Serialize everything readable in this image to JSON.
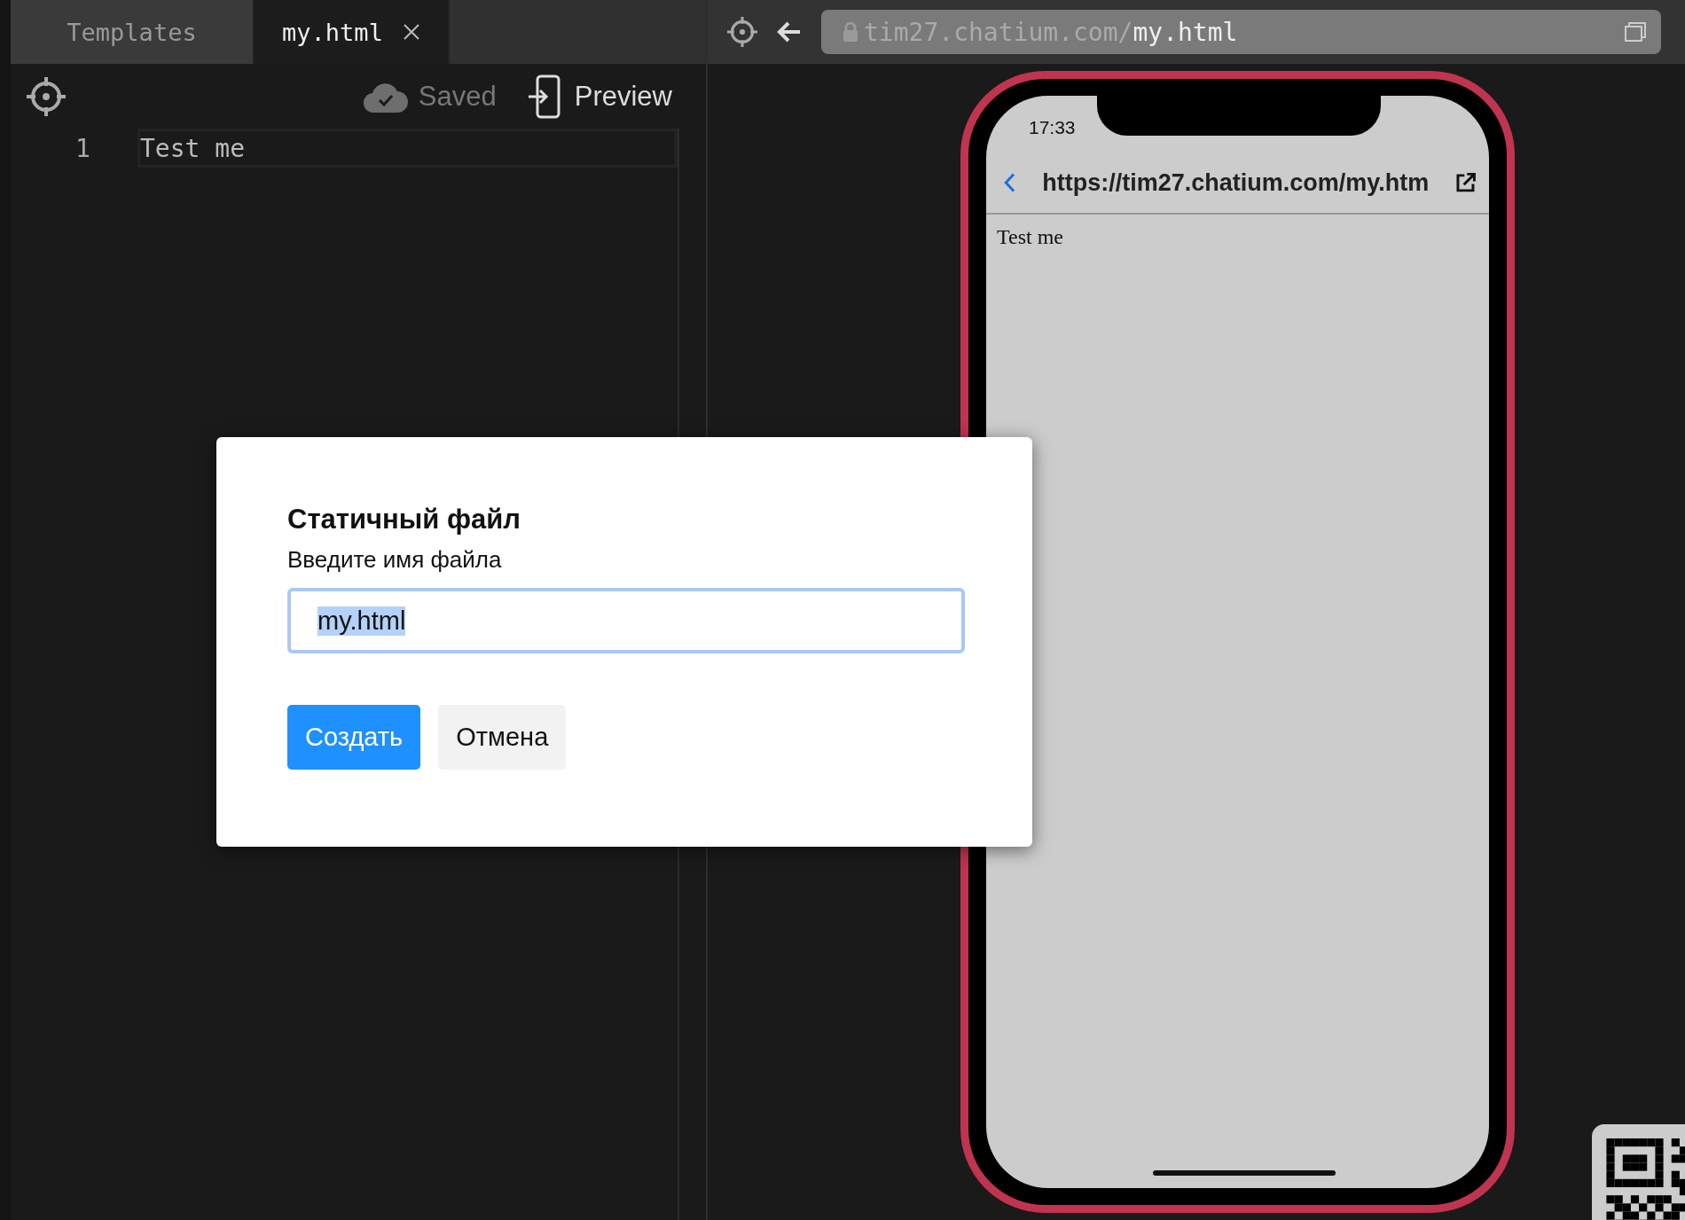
{
  "tabs": [
    {
      "label": "Templates",
      "selected": false,
      "closable": false
    },
    {
      "label": "my.html",
      "selected": true,
      "closable": true
    }
  ],
  "editor_toolbar": {
    "save_status": "Saved",
    "preview_button": "Preview"
  },
  "editor": {
    "lines": [
      {
        "number": "1",
        "text": "Test me"
      }
    ]
  },
  "preview": {
    "address_bar": {
      "host": "tim27.chatium.com/",
      "path": "my.html"
    },
    "phone": {
      "time": "17:33",
      "url": "https://tim27.chatium.com/my.htm",
      "page_text": "Test me"
    }
  },
  "dialog": {
    "title": "Статичный файл",
    "label": "Введите имя файла",
    "input_value": "my.html",
    "value_selected": true,
    "buttons": [
      {
        "label": "Создать",
        "kind": "primary"
      },
      {
        "label": "Отмена",
        "kind": "secondary"
      }
    ]
  }
}
